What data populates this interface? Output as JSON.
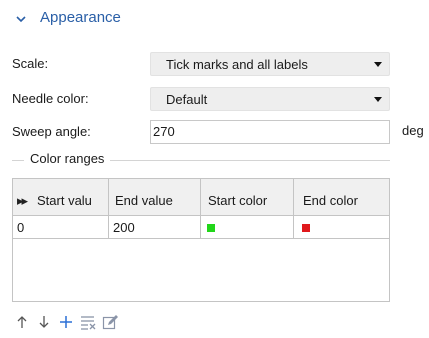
{
  "section": {
    "title": "Appearance"
  },
  "form": {
    "scale": {
      "label": "Scale:",
      "value": "Tick marks and all labels"
    },
    "needle_color": {
      "label": "Needle color:",
      "value": "Default"
    },
    "sweep_angle": {
      "label": "Sweep angle:",
      "value": "270",
      "unit": "deg"
    }
  },
  "color_ranges": {
    "group_label": "Color ranges",
    "columns": [
      "Start valu",
      "End value",
      "Start color",
      "End color"
    ],
    "rows": [
      {
        "start_value": "0",
        "end_value": "200",
        "start_color": "#22d61a",
        "end_color": "#e0191c"
      }
    ]
  },
  "toolbar": {
    "icons": [
      "arrow-up-icon",
      "arrow-down-icon",
      "add-icon",
      "clear-table-icon",
      "edit-icon"
    ]
  },
  "colors": {
    "accent": "#2a5fa7"
  }
}
